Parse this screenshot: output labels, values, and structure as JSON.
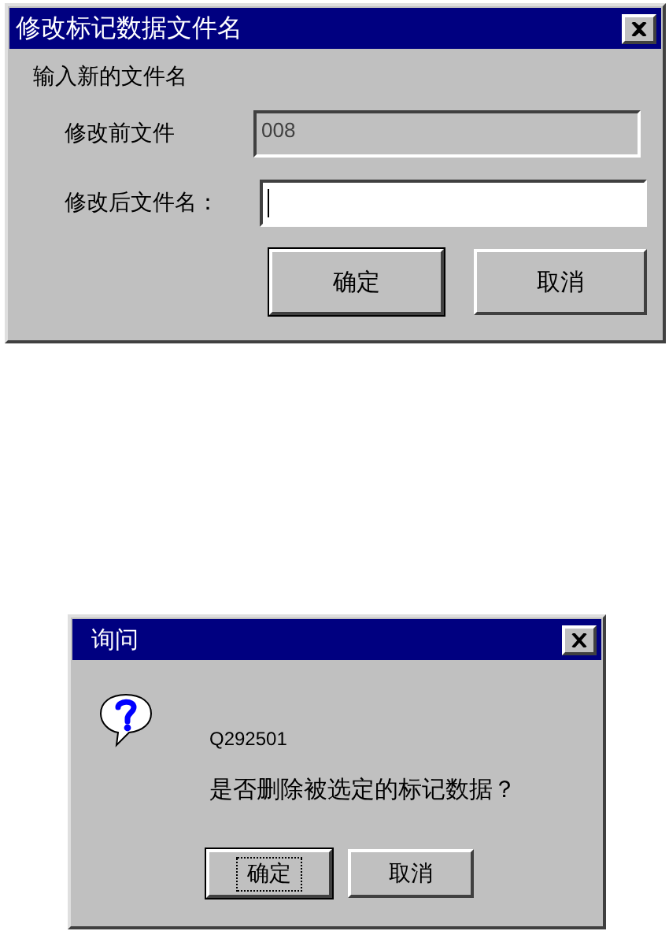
{
  "rename_dialog": {
    "title": "修改标记数据文件名",
    "prompt": "输入新的文件名",
    "fields": [
      {
        "label": "修改前文件",
        "value": "008",
        "disabled": true
      },
      {
        "label": "修改后文件名：",
        "disabled": false
      }
    ],
    "buttons": [
      {
        "label": "确定",
        "default": true,
        "focused": false
      },
      {
        "label": "取消",
        "default": false,
        "focused": false
      }
    ]
  },
  "confirm_dialog": {
    "title": "询问",
    "code": "Q292501",
    "message": "是否删除被选定的标记数据？",
    "buttons": [
      {
        "label": "确定",
        "default": true,
        "focused": true
      },
      {
        "label": "取消",
        "default": false,
        "focused": false
      }
    ]
  }
}
